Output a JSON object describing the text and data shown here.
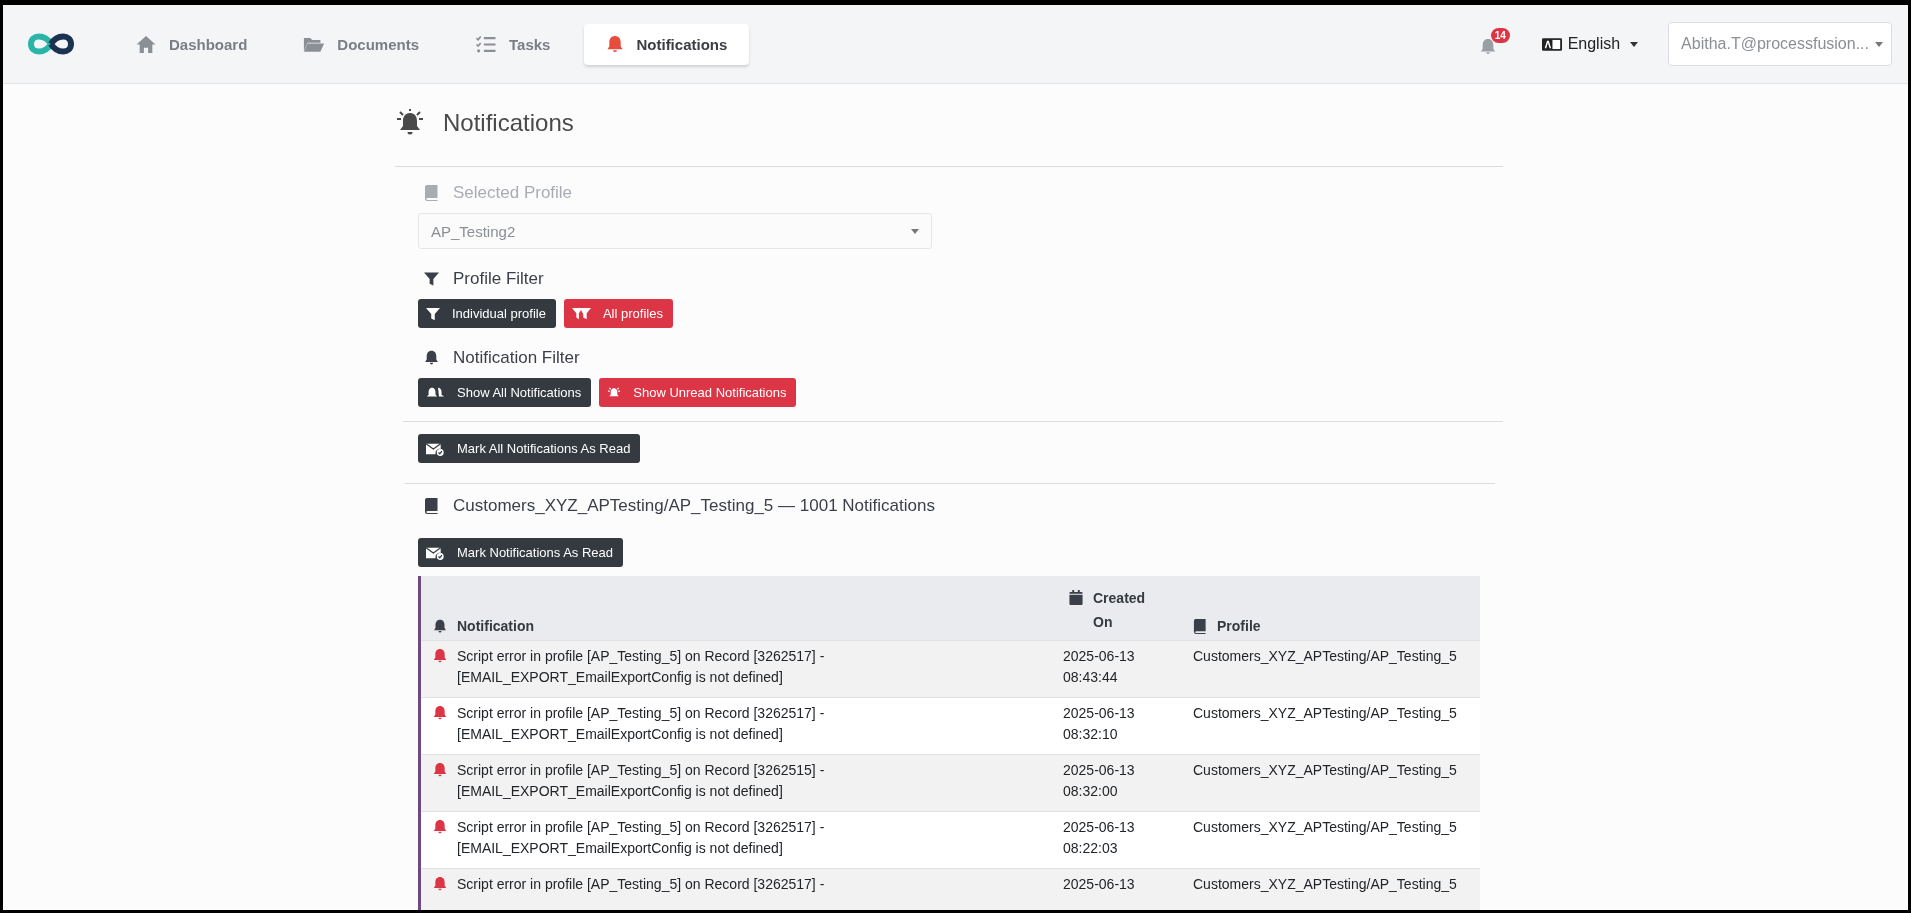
{
  "nav": {
    "tabs": [
      {
        "label": "Dashboard",
        "selected": false
      },
      {
        "label": "Documents",
        "selected": false
      },
      {
        "label": "Tasks",
        "selected": false
      },
      {
        "label": "Notifications",
        "selected": true
      }
    ],
    "notification_count": "14",
    "language": "English",
    "user": "Abitha.T@processfusion..."
  },
  "page_title": "Notifications",
  "selected_profile": {
    "label": "Selected Profile",
    "value": "AP_Testing2"
  },
  "profile_filter": {
    "label": "Profile Filter",
    "buttons": [
      {
        "label": "Individual profile",
        "kind": "dark"
      },
      {
        "label": "All profiles",
        "kind": "danger"
      }
    ]
  },
  "notification_filter": {
    "label": "Notification Filter",
    "buttons": [
      {
        "label": "Show All Notifications",
        "kind": "dark"
      },
      {
        "label": "Show Unread Notifications",
        "kind": "danger"
      }
    ]
  },
  "mark_all_button": "Mark All Notifications As Read",
  "group": {
    "heading": "Customers_XYZ_APTesting/AP_Testing_5 — 1001 Notifications",
    "mark_button": "Mark Notifications As Read",
    "columns": [
      "Notification",
      "Created On",
      "Profile"
    ],
    "rows": [
      {
        "lines": [
          "Script error in profile [AP_Testing_5] on Record [3262517] -",
          "[EMAIL_EXPORT_EmailExportConfig is not defined]"
        ],
        "created": [
          "2025-06-13",
          "08:43:44"
        ],
        "profile": "Customers_XYZ_APTesting/AP_Testing_5"
      },
      {
        "lines": [
          "Script error in profile [AP_Testing_5] on Record [3262517] -",
          "[EMAIL_EXPORT_EmailExportConfig is not defined]"
        ],
        "created": [
          "2025-06-13",
          "08:32:10"
        ],
        "profile": "Customers_XYZ_APTesting/AP_Testing_5"
      },
      {
        "lines": [
          "Script error in profile [AP_Testing_5] on Record [3262515] -",
          "[EMAIL_EXPORT_EmailExportConfig is not defined]"
        ],
        "created": [
          "2025-06-13",
          "08:32:00"
        ],
        "profile": "Customers_XYZ_APTesting/AP_Testing_5"
      },
      {
        "lines": [
          "Script error in profile [AP_Testing_5] on Record [3262517] -",
          "[EMAIL_EXPORT_EmailExportConfig is not defined]"
        ],
        "created": [
          "2025-06-13",
          "08:22:03"
        ],
        "profile": "Customers_XYZ_APTesting/AP_Testing_5"
      },
      {
        "lines": [
          "Script error in profile [AP_Testing_5] on Record [3262517] -"
        ],
        "created": [
          "2025-06-13"
        ],
        "profile": "Customers_XYZ_APTesting/AP_Testing_5"
      }
    ]
  }
}
